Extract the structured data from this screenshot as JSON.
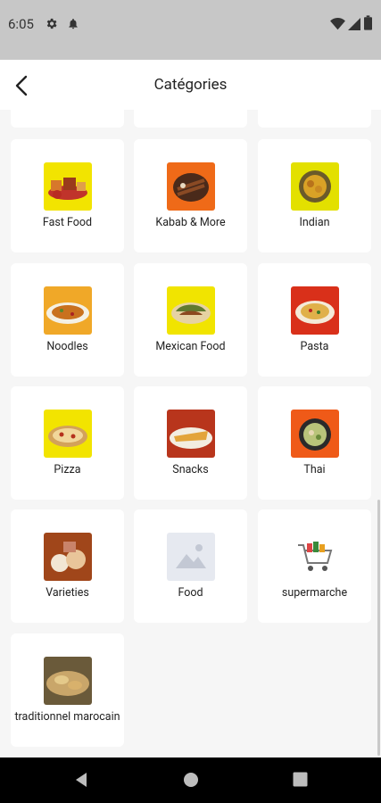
{
  "status_bar": {
    "time": "6:05"
  },
  "app_bar": {
    "title": "Catégories"
  },
  "categories": [
    {
      "label": "Fast Food",
      "icon": "fast-food-image"
    },
    {
      "label": "Kabab & More",
      "icon": "kabab-image"
    },
    {
      "label": "Indian",
      "icon": "indian-food-image"
    },
    {
      "label": "Noodles",
      "icon": "noodles-image"
    },
    {
      "label": "Mexican Food",
      "icon": "mexican-food-image"
    },
    {
      "label": "Pasta",
      "icon": "pasta-image"
    },
    {
      "label": "Pizza",
      "icon": "pizza-image"
    },
    {
      "label": "Snacks",
      "icon": "snacks-image"
    },
    {
      "label": "Thai",
      "icon": "thai-food-image"
    },
    {
      "label": "Varieties",
      "icon": "varieties-image"
    },
    {
      "label": "Food",
      "icon": "image-placeholder-icon"
    },
    {
      "label": "supermarche",
      "icon": "shopping-cart-image"
    },
    {
      "label": "traditionnel marocain",
      "icon": "moroccan-food-image"
    }
  ],
  "colors": {
    "app_bar": "#ffffff",
    "background": "#f6f6f6",
    "status_bar": "#c7c7c7",
    "nav_bar": "#000000"
  }
}
